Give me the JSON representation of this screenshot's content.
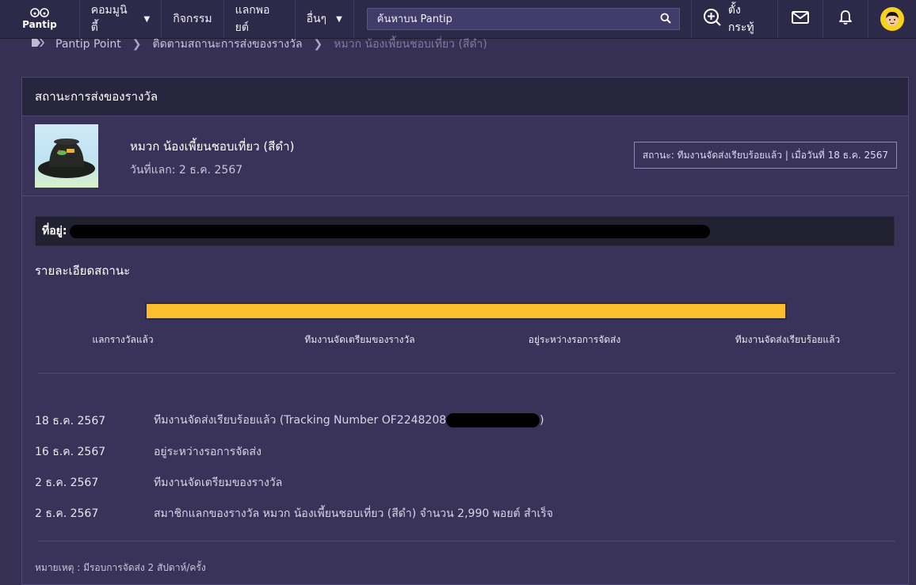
{
  "nav": {
    "logo_text": "Pantip",
    "items": [
      {
        "label": "คอมมูนิตี้",
        "caret": true
      },
      {
        "label": "กิจกรรม",
        "caret": false
      },
      {
        "label": "แลกพอยต์",
        "caret": false
      },
      {
        "label": "อื่นๆ",
        "caret": true
      }
    ],
    "search_placeholder": "ค้นหาบน Pantip",
    "create_label": "ตั้งกระทู้"
  },
  "breadcrumb": [
    "Pantip Point",
    "ติดตามสถานะการส่งของรางวัล",
    "หมวก น้องเพี้ยนชอบเที่ยว (สีดำ)"
  ],
  "card": {
    "title": "สถานะการส่งของรางวัล",
    "product_name": "หมวก น้องเพี้ยนชอบเที่ยว (สีดำ)",
    "redeem_date": "วันที่แลก: 2 ธ.ค. 2567",
    "status": "สถานะ: ทีมงานจัดส่งเรียบร้อยแล้ว | เมื่อวันที่ 18 ธ.ค. 2567",
    "address_label": "ที่อยู่:",
    "detail_title": "รายละเอียดสถานะ",
    "progress_percent": 100,
    "steps": [
      "แลกรางวัลแล้ว",
      "ทีมงานจัดเตรียมของรางวัล",
      "อยู่ระหว่างรอการจัดส่ง",
      "ทีมงานจัดส่งเรียบร้อยแล้ว"
    ],
    "history": [
      {
        "date": "18 ธ.ค. 2567",
        "text": "ทีมงานจัดส่งเรียบร้อยแล้ว (Tracking Number OF2248208",
        "text_after": ")"
      },
      {
        "date": "16 ธ.ค. 2567",
        "text": "อยู่ระหว่างรอการจัดส่ง",
        "text_after": ""
      },
      {
        "date": "2 ธ.ค. 2567",
        "text": "ทีมงานจัดเตรียมของรางวัล",
        "text_after": ""
      },
      {
        "date": "2 ธ.ค. 2567",
        "text": "สมาชิกแลกของรางวัล หมวก น้องเพี้ยนชอบเที่ยว (สีดำ) จำนวน 2,990 พอยต์ สำเร็จ",
        "text_after": ""
      }
    ],
    "note": "หมายเหตุ : มีรอบการจัดส่ง 2 สัปดาห์/ครั้ง"
  },
  "colors": {
    "progress": "#fbbf2d",
    "background": "#353054",
    "header": "#28253f"
  }
}
